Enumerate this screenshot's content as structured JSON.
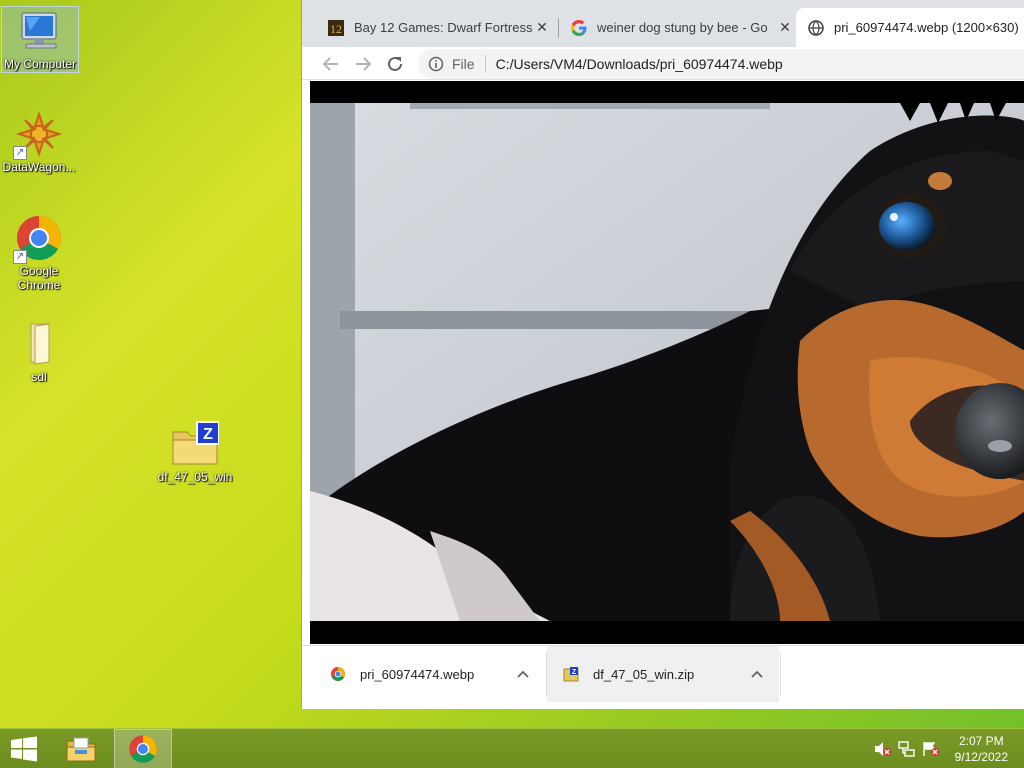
{
  "desktop": {
    "icons": [
      {
        "label": "My Computer"
      },
      {
        "label": "DataWagon..."
      },
      {
        "label": "Google Chrome"
      },
      {
        "label": "sdl"
      },
      {
        "label": "df_47_05_win"
      }
    ]
  },
  "browser": {
    "tabs": [
      {
        "title": "Bay 12 Games: Dwarf Fortress",
        "favicon": "dwarf-fortress-12-icon"
      },
      {
        "title": "weiner dog stung by bee - Google Search",
        "favicon": "google-g-icon"
      },
      {
        "title": "pri_60974474.webp (1200×630)",
        "favicon": "globe-icon"
      }
    ],
    "omnibox": {
      "scheme": "File",
      "url": "C:/Users/VM4/Downloads/pri_60974474.webp"
    },
    "downloads": [
      {
        "filename": "pri_60974474.webp",
        "icon": "chrome-file-icon"
      },
      {
        "filename": "df_47_05_win.zip",
        "icon": "zip-file-icon"
      }
    ]
  },
  "taskbar": {
    "time": "2:07 PM",
    "date": "9/12/2022"
  },
  "colors": {
    "tabstrip": "#dee1e6",
    "taskbar": "#6d8c1f",
    "desktop_accent": "#c6db1c"
  }
}
